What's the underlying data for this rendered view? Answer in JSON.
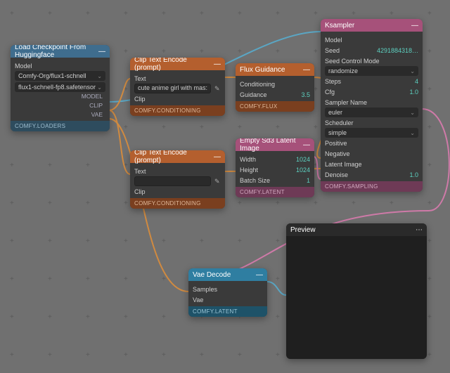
{
  "grid_glyph": "+",
  "nodes": {
    "checkpoint": {
      "title": "Load Checkpoint From Huggingface",
      "label_model": "Model",
      "repo": "Comfy-Org/flux1-schnell",
      "file": "flux1-schnell-fp8.safetensor",
      "out1": "MODEL",
      "out2": "CLIP",
      "out3": "VAE",
      "footer": "COMFY.LOADERS"
    },
    "encode_pos": {
      "title": "Clip Text Encode (prompt)",
      "label_text": "Text",
      "value_text": "cute anime girl with mas:",
      "label_clip": "Clip",
      "footer": "COMFY.CONDITIONING"
    },
    "encode_neg": {
      "title": "Clip Text Encode (prompt)",
      "label_text": "Text",
      "value_text": "",
      "label_clip": "Clip",
      "footer": "COMFY.CONDITIONING"
    },
    "flux": {
      "title": "Flux Guidance",
      "label_cond": "Conditioning",
      "label_guidance": "Guidance",
      "value_guidance": "3.5",
      "footer": "COMFY.FLUX"
    },
    "latent": {
      "title": "Empty Sd3 Latent Image",
      "label_w": "Width",
      "value_w": "1024",
      "label_h": "Height",
      "value_h": "1024",
      "label_b": "Batch Size",
      "value_b": "1",
      "footer": "COMFY.LATENT"
    },
    "ksampler": {
      "title": "Ksampler",
      "label_model": "Model",
      "label_seed": "Seed",
      "value_seed": "4291884318…",
      "label_seedctrl": "Seed Control Mode",
      "value_seedctrl": "randomize",
      "label_steps": "Steps",
      "value_steps": "4",
      "label_cfg": "Cfg",
      "value_cfg": "1.0",
      "label_sampler": "Sampler Name",
      "value_sampler": "euler",
      "label_sched": "Scheduler",
      "value_sched": "simple",
      "label_pos": "Positive",
      "label_neg": "Negative",
      "label_latent": "Latent Image",
      "label_denoise": "Denoise",
      "value_denoise": "1.0",
      "footer": "COMFY.SAMPLING"
    },
    "vae": {
      "title": "Vae Decode",
      "label_samples": "Samples",
      "label_vae": "Vae",
      "footer": "COMFY.LATENT"
    },
    "preview": {
      "title": "Preview"
    }
  },
  "colors": {
    "wire_blue": "#5aa6c4",
    "wire_orange": "#d08a40",
    "wire_pink": "#cf7aa8",
    "wire_white": "#e0e0e0"
  }
}
